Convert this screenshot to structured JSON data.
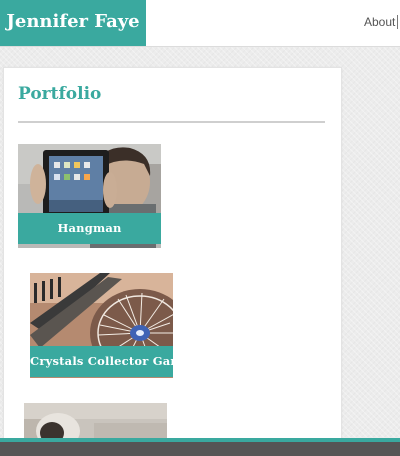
{
  "header": {
    "brand": "Jennifer Faye",
    "nav": [
      {
        "label": "About"
      }
    ]
  },
  "main": {
    "title": "Portfolio",
    "projects": [
      {
        "label": "Hangman",
        "image": "person-holding-ipad-photo"
      },
      {
        "label": "Crystals Collector Game",
        "image": "spinning-carnival-ride-photo"
      },
      {
        "label": "",
        "image": "partial-project-photo"
      }
    ]
  },
  "colors": {
    "accent": "#3aa99f",
    "footer": "#555555",
    "background": "#ececec"
  }
}
